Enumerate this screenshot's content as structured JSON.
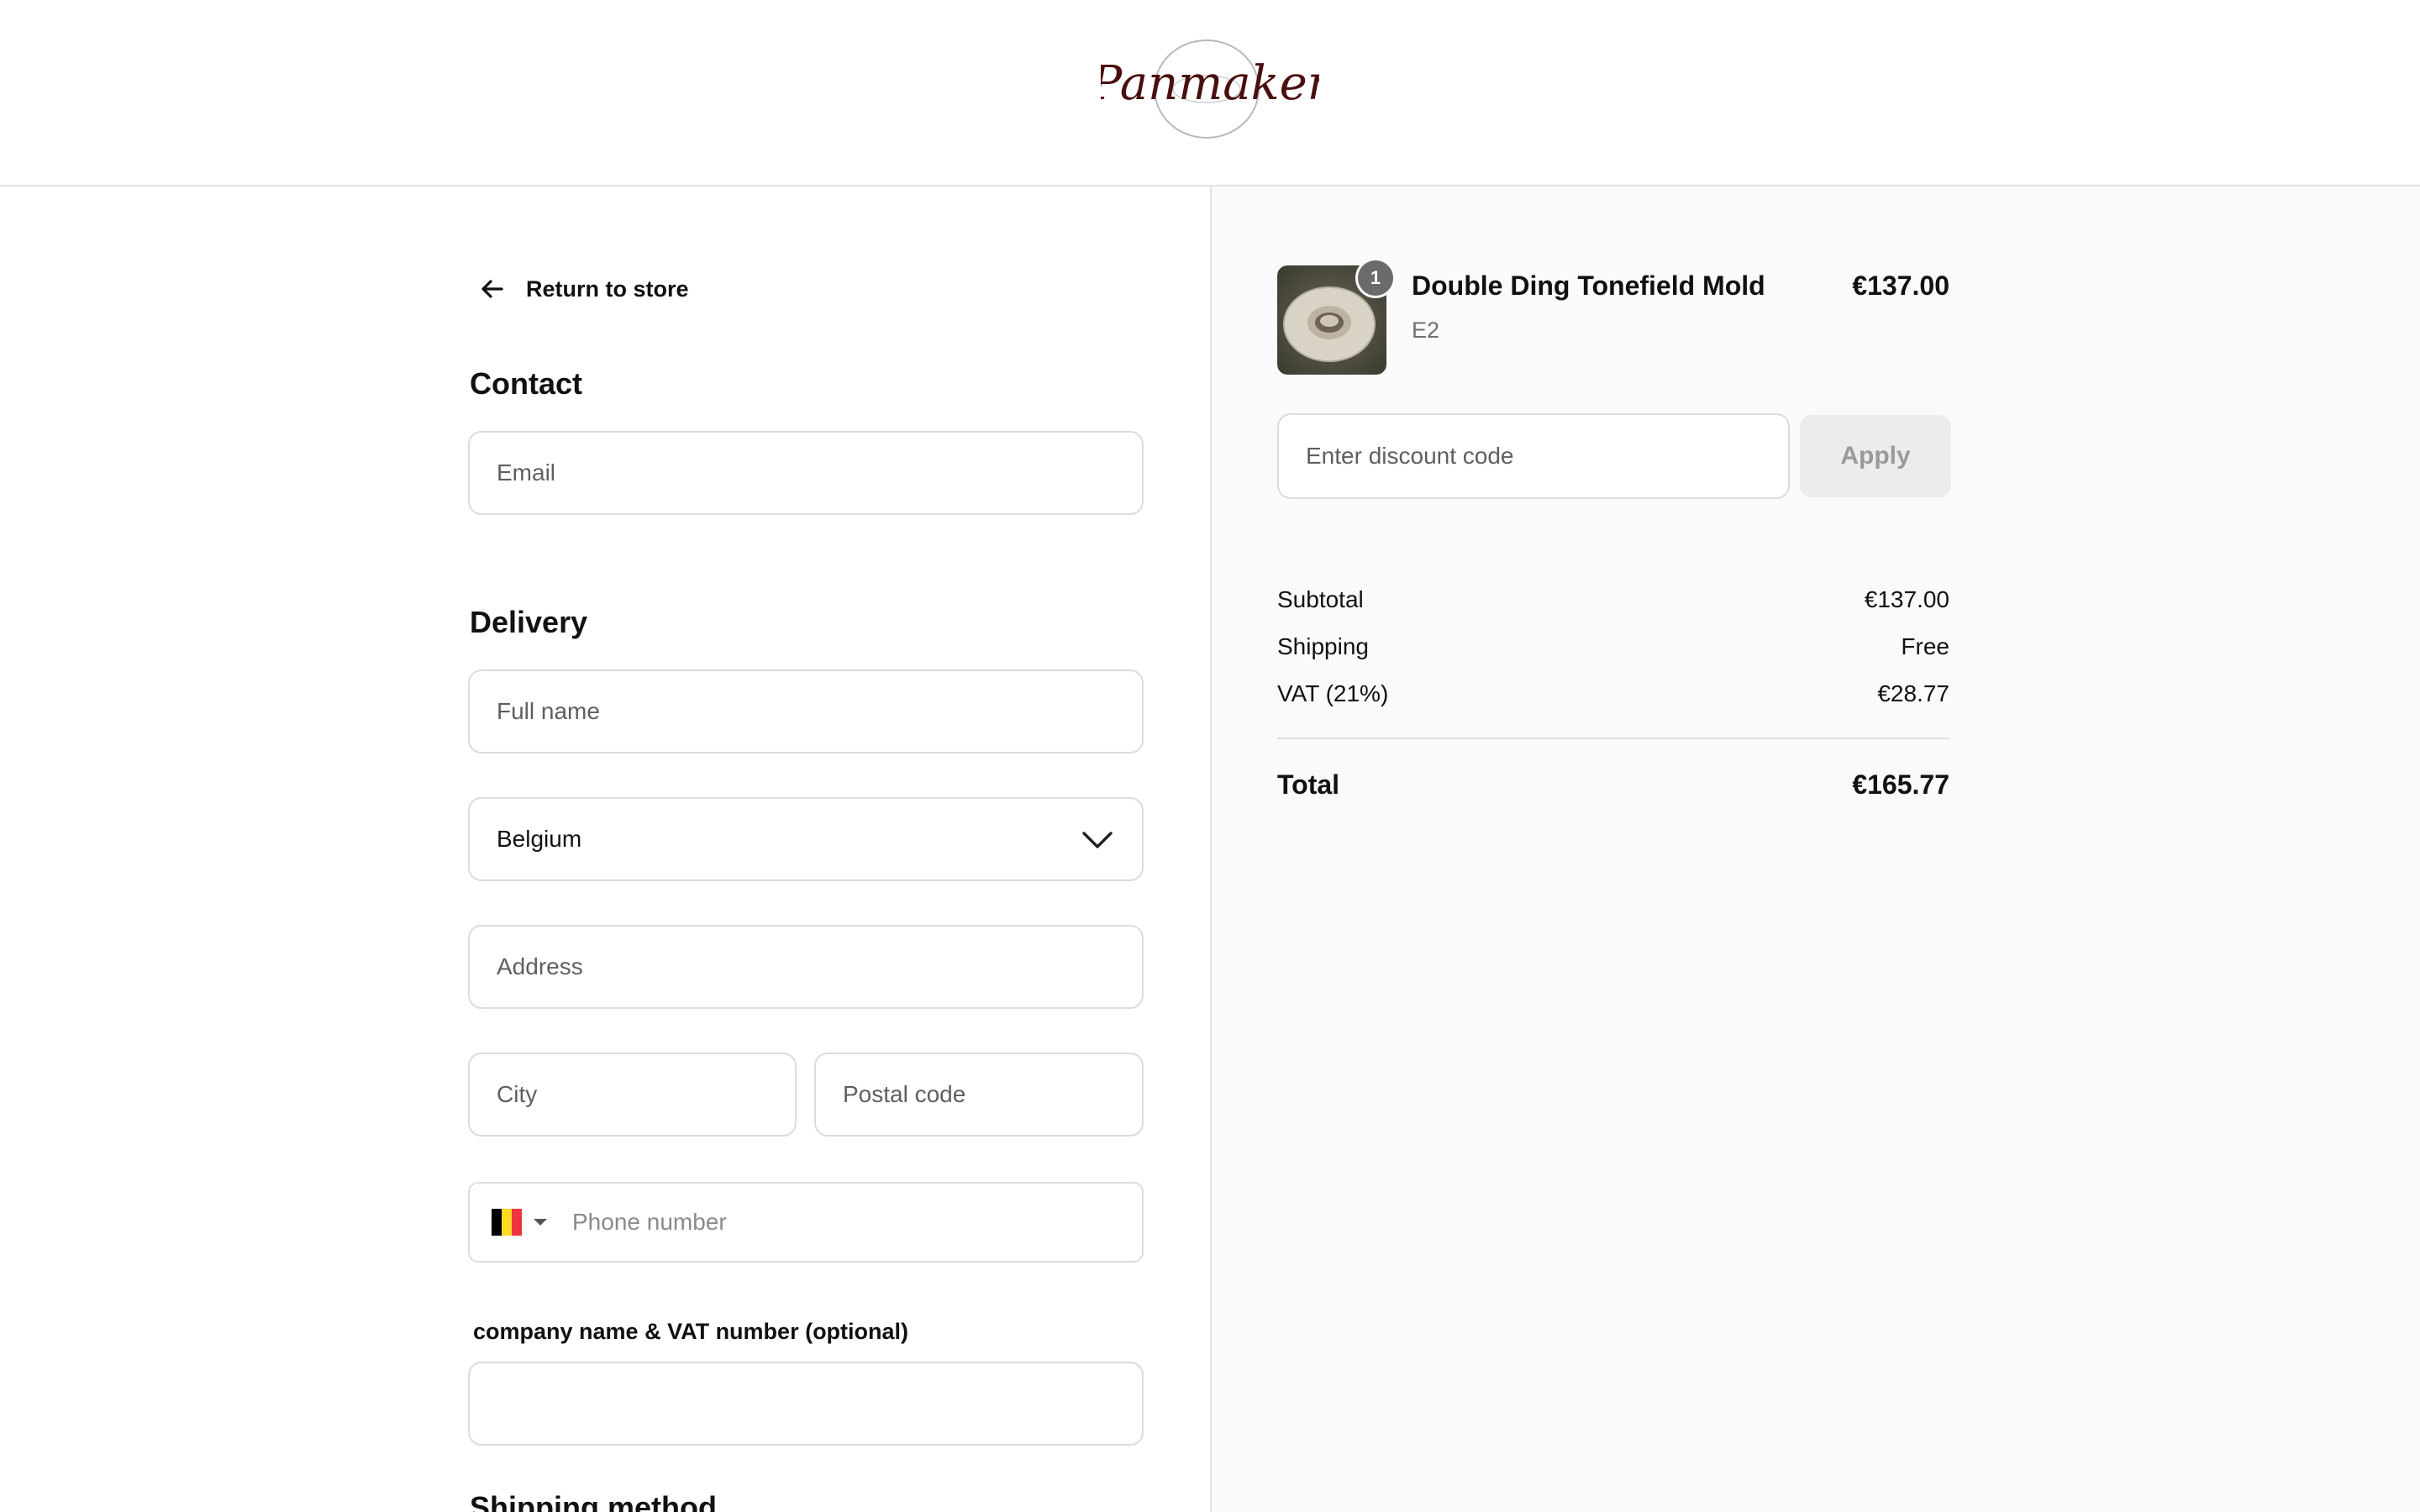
{
  "brand": {
    "logo_text": "Panmaker"
  },
  "nav": {
    "return_label": "Return to store"
  },
  "contact": {
    "title": "Contact",
    "email_placeholder": "Email"
  },
  "delivery": {
    "title": "Delivery",
    "full_name_placeholder": "Full name",
    "country_value": "Belgium",
    "address_placeholder": "Address",
    "city_placeholder": "City",
    "postal_placeholder": "Postal code",
    "phone_placeholder": "Phone number",
    "phone_flag_colors": [
      "#000000",
      "#FDDA24",
      "#EF3340"
    ],
    "company_label": "company name & VAT number (optional)"
  },
  "shipping_method": {
    "title": "Shipping method"
  },
  "cart": {
    "item": {
      "name": "Double Ding Tonefield Mold",
      "variant": "E2",
      "price": "€137.00",
      "quantity": "1"
    },
    "discount_placeholder": "Enter discount code",
    "apply_label": "Apply",
    "summary": [
      {
        "label": "Subtotal",
        "value": "€137.00"
      },
      {
        "label": "Shipping",
        "value": "Free"
      },
      {
        "label": "VAT (21%)",
        "value": "€28.77"
      }
    ],
    "total": {
      "label": "Total",
      "value": "€165.77"
    }
  },
  "colors": {
    "logo": "#4a0f0f",
    "panel_bg": "#fafafa",
    "border": "#dcdcdc",
    "badge": "#6b6b6b"
  }
}
